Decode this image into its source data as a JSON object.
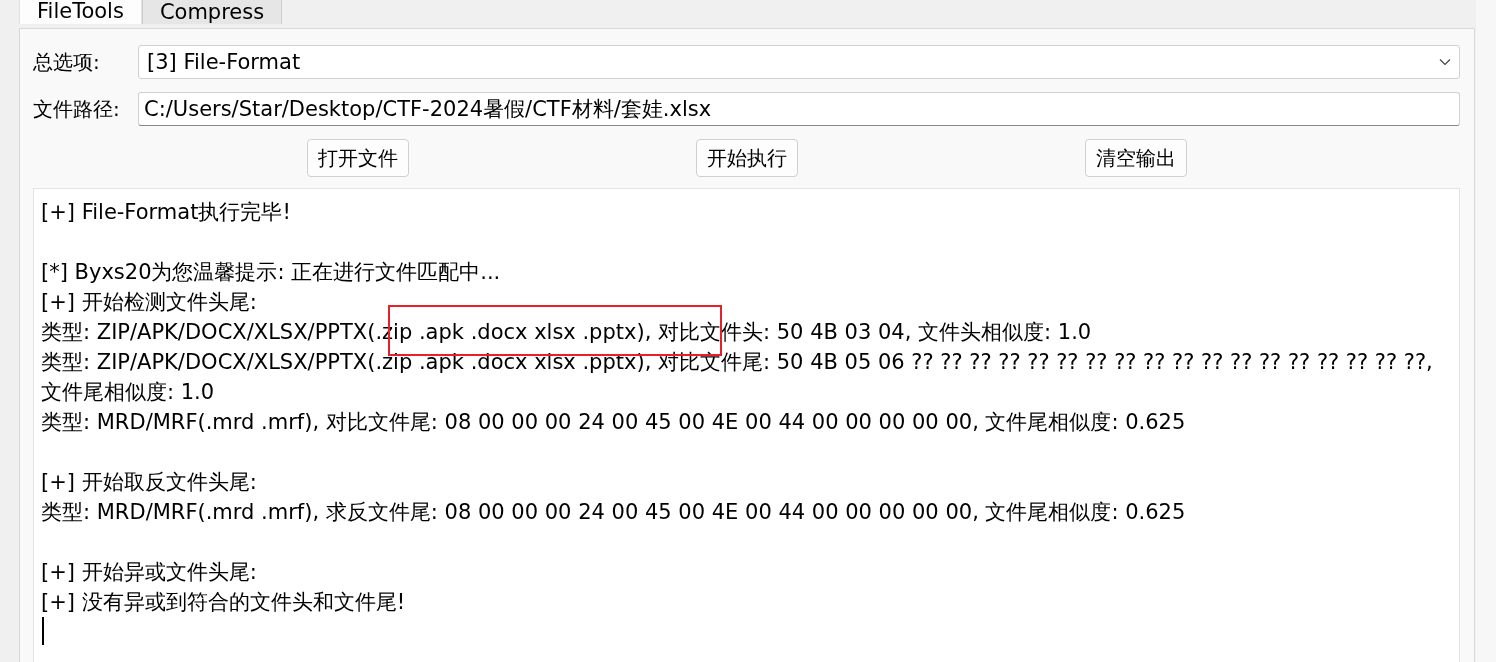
{
  "tabs": [
    {
      "label": "FileTools",
      "selected": true
    },
    {
      "label": "Compress",
      "selected": false
    }
  ],
  "options": {
    "label": "总选项:",
    "value": "[3] File-Format"
  },
  "file_path": {
    "label": "文件路径:",
    "value": "C:/Users/Star/Desktop/CTF-2024暑假/CTF材料/套娃.xlsx"
  },
  "buttons": [
    "打开文件",
    "开始执行",
    "清空输出"
  ],
  "output": {
    "groups": [
      [
        "[+] File-Format执行完毕!"
      ],
      [
        "[*] Byxs20为您温馨提示: 正在进行文件匹配中...",
        "[+] 开始检测文件头尾:",
        "类型: ZIP/APK/DOCX/XLSX/PPTX(.zip .apk .docx xlsx .pptx), 对比文件头: 50 4B 03 04, 文件头相似度: 1.0",
        "类型: ZIP/APK/DOCX/XLSX/PPTX(.zip .apk .docx xlsx .pptx), 对比文件尾: 50 4B 05 06 ?? ?? ?? ?? ?? ?? ?? ?? ?? ?? ?? ?? ?? ?? ?? ?? ?? ??,",
        "文件尾相似度: 1.0",
        "类型: MRD/MRF(.mrd .mrf), 对比文件尾: 08 00 00 00 24 00 45 00 4E 00 44 00 00 00 00 00, 文件尾相似度: 0.625"
      ],
      [
        "[+] 开始取反文件头尾:",
        "类型: MRD/MRF(.mrd .mrf), 求反文件尾: 08 00 00 00 24 00 45 00 4E 00 44 00 00 00 00 00, 文件尾相似度: 0.625"
      ],
      [
        "[+] 开始异或文件头尾:",
        "[+] 没有异或到符合的文件头和文件尾!"
      ]
    ]
  }
}
